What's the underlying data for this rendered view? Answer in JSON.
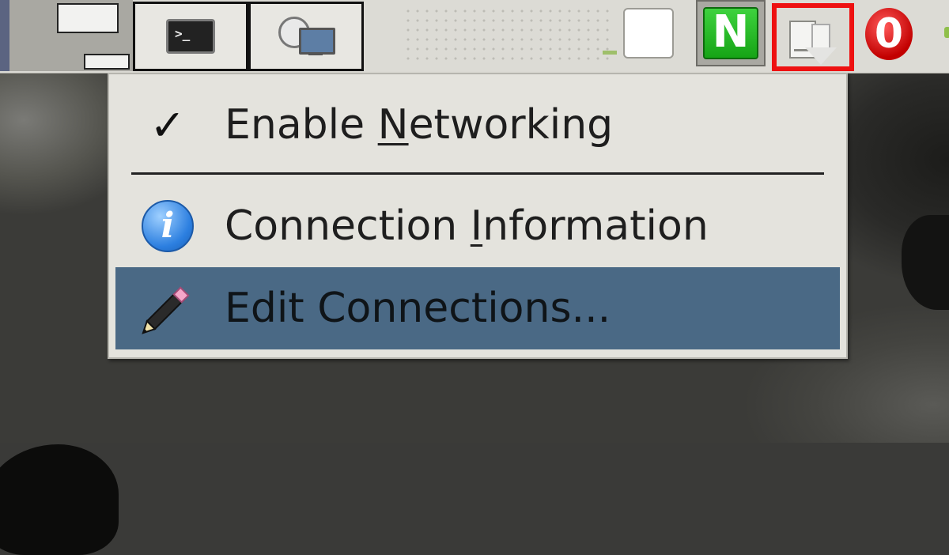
{
  "panel": {
    "launchers": [
      {
        "name": "terminal",
        "icon": "terminal-icon",
        "prompt_glyph": ">_"
      },
      {
        "name": "network-browser",
        "icon": "network-computer-icon"
      }
    ],
    "tray": {
      "nm_applet_highlight_color": "#ee1111",
      "n_badge_text": "N",
      "zero_badge_text": "0"
    }
  },
  "menu": {
    "items": [
      {
        "label_before": "Enable ",
        "mnemonic": "N",
        "label_after": "etworking",
        "icon": "checkmark-icon",
        "checked": true
      },
      {
        "label_before": "Connection ",
        "mnemonic": "I",
        "label_after": "nformation",
        "icon": "info-icon"
      },
      {
        "label": "Edit Connections...",
        "icon": "pencil-icon",
        "highlighted": true
      }
    ],
    "highlight_color": "#4a6985",
    "background_color": "#e4e3dd"
  }
}
